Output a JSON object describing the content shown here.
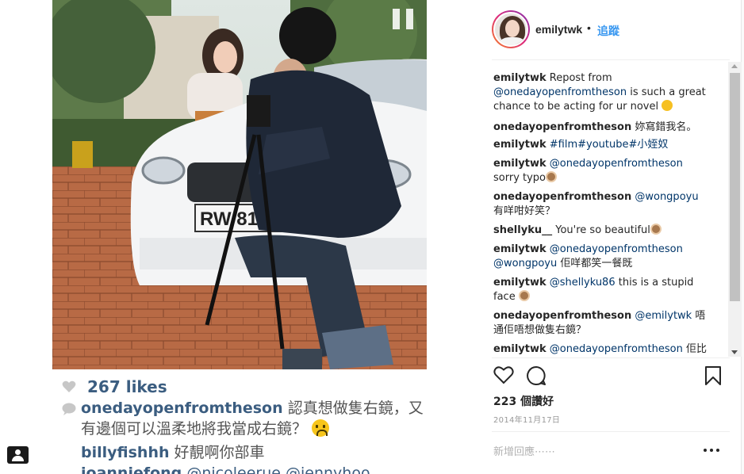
{
  "post": {
    "username": "emilytwk",
    "separator": "•",
    "follow_label": "追蹤"
  },
  "media": {
    "likes": "267 likes",
    "comments": [
      {
        "user": "onedayopenfromtheson",
        "text": "認真想做隻右鏡，又",
        "text2": "有邊個可以溫柔地將我當成右鏡？"
      },
      {
        "user": "billyfishhh",
        "text": "好靚啊你部車"
      },
      {
        "user": "joanniefong",
        "text": "@nicoleerue @jennyhoo"
      }
    ]
  },
  "comments": [
    {
      "user": "emilytwk",
      "parts": [
        {
          "t": "Repost from "
        },
        {
          "t": "@onedayopenfromtheson",
          "m": true
        },
        {
          "t": " is such a great chance to be acting for ur novel "
        }
      ],
      "emoji": "smile-emoji"
    },
    {
      "user": "onedayopenfromtheson",
      "parts": [
        {
          "t": "妳寫錯我名。"
        }
      ]
    },
    {
      "user": "emilytwk",
      "parts": [
        {
          "t": "#film#youtube#小姪奴",
          "m": true
        }
      ]
    },
    {
      "user": "emilytwk",
      "parts": [
        {
          "t": "@onedayopenfromtheson",
          "m": true
        },
        {
          "t": " sorry typo"
        }
      ],
      "emoji": "monkey-emoji"
    },
    {
      "user": "onedayopenfromtheson",
      "parts": [
        {
          "t": "@wongpoyu",
          "m": true
        },
        {
          "t": " 有咩咁好笑？"
        }
      ]
    },
    {
      "user": "shellyku__",
      "parts": [
        {
          "t": "You're so beautiful"
        }
      ],
      "emoji": "monkey-emoji"
    },
    {
      "user": "emilytwk",
      "parts": [
        {
          "t": "@onedayopenfromtheson @wongpoyu",
          "m": true
        },
        {
          "t": " 佢咩都笑一餐既"
        }
      ]
    },
    {
      "user": "emilytwk",
      "parts": [
        {
          "t": "@shellyku86",
          "m": true
        },
        {
          "t": " this is a stupid face "
        }
      ],
      "emoji": "monkey-emoji"
    },
    {
      "user": "onedayopenfromtheson",
      "parts": [
        {
          "t": "@emilytwk",
          "m": true
        },
        {
          "t": " 唔通佢唔想做隻右鏡？"
        }
      ]
    },
    {
      "user": "emilytwk",
      "parts": [
        {
          "t": "@onedayopenfromtheson",
          "m": true
        },
        {
          "t": " 佢比"
        }
      ]
    }
  ],
  "stats": {
    "views": "223 個讚好",
    "date": "2014年11月17日"
  },
  "add_comment": {
    "placeholder": "新增回應⋯⋯"
  },
  "icons": {
    "pause": "pause-icon",
    "like": "heart-outline-icon",
    "comment": "comment-bubble-icon",
    "save": "bookmark-icon",
    "more": "more-horizontal-icon",
    "profile": "profile-badge-icon"
  },
  "colors": {
    "link": "#003569",
    "follow": "#3897f0",
    "secondary": "#999999"
  }
}
